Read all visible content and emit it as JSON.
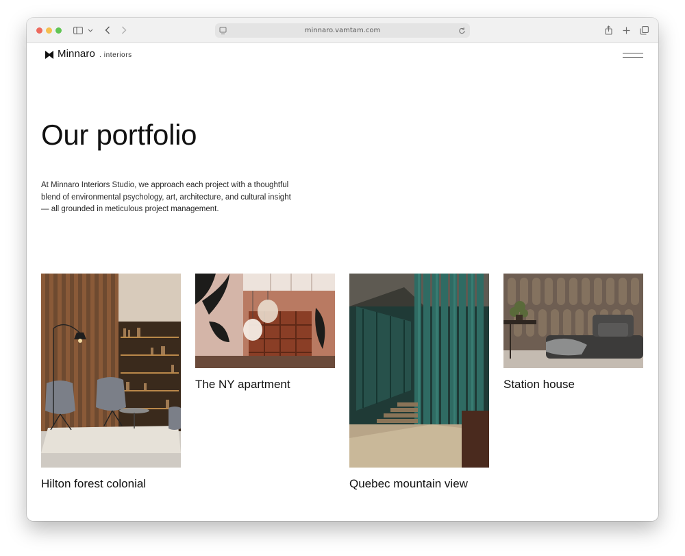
{
  "browser": {
    "url": "minnaro.vamtam.com"
  },
  "site": {
    "logo_name": "Minnaro",
    "logo_sub": ". interiors"
  },
  "page": {
    "title": "Our portfolio",
    "intro": "At Minnaro Interiors Studio, we approach each project with a thoughtful blend of environmental psychology, art, architecture, and cultural insight — all grounded in meticulous project management."
  },
  "portfolio": [
    {
      "title": "Hilton forest colonial"
    },
    {
      "title": "The NY apartment"
    },
    {
      "title": "Quebec mountain view"
    },
    {
      "title": "Station house"
    }
  ],
  "colors": {
    "traffic_red": "#ed6a5e",
    "traffic_yellow": "#f5bf4f",
    "traffic_green": "#61c554",
    "text_dark": "#111111"
  }
}
